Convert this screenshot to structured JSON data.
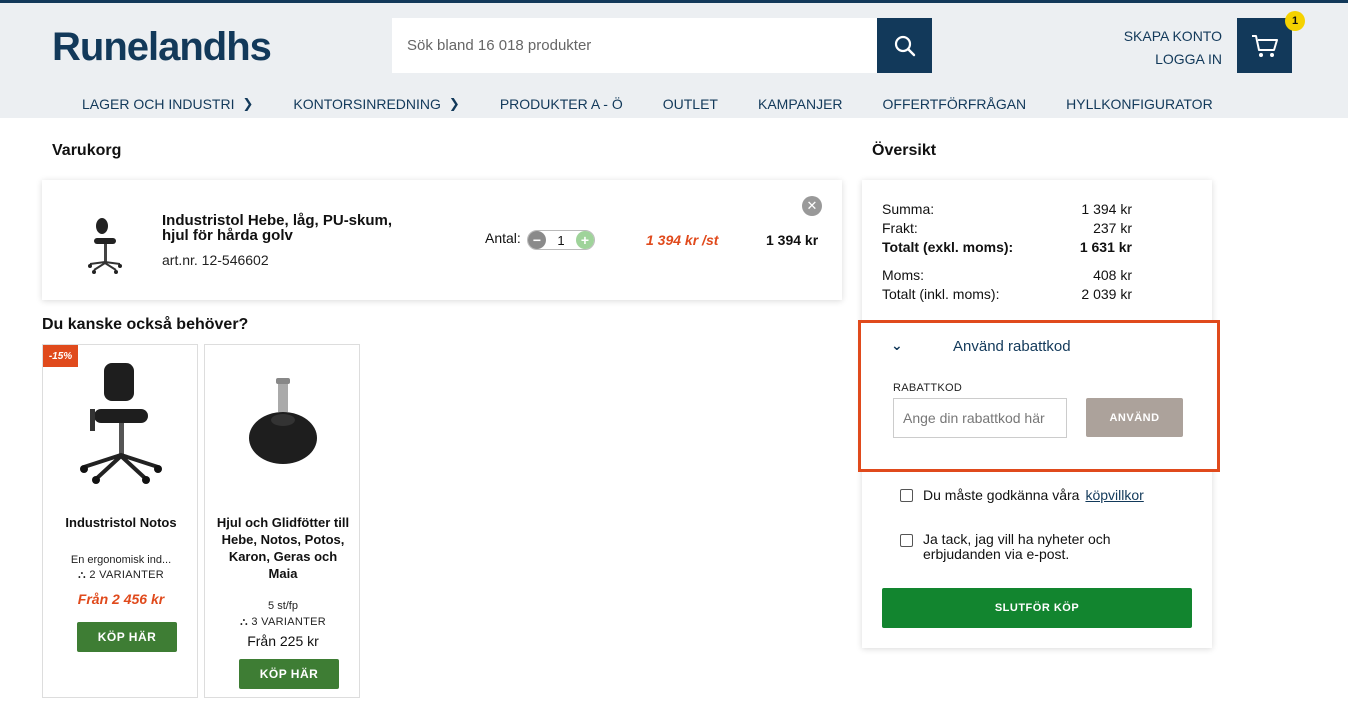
{
  "header": {
    "logo": "Runelandhs",
    "search_placeholder": "Sök bland 16 018 produkter",
    "create_account": "SKAPA KONTO",
    "login": "LOGGA IN",
    "cart_count": "1"
  },
  "nav": [
    {
      "label": "LAGER OCH INDUSTRI",
      "has_chevron": true
    },
    {
      "label": "KONTORSINREDNING",
      "has_chevron": true
    },
    {
      "label": "PRODUKTER A - Ö",
      "has_chevron": false
    },
    {
      "label": "OUTLET",
      "has_chevron": false
    },
    {
      "label": "KAMPANJER",
      "has_chevron": false
    },
    {
      "label": "OFFERTFÖRFRÅGAN",
      "has_chevron": false
    },
    {
      "label": "HYLLKONFIGURATOR",
      "has_chevron": false
    }
  ],
  "cart": {
    "heading": "Varukorg",
    "item": {
      "name": "Industristol Hebe, låg, PU-skum, hjul för hårda golv",
      "art_nr": "art.nr. 12-546602",
      "qty_label": "Antal:",
      "qty": "1",
      "unit_price": "1 394 kr /st",
      "total": "1 394 kr"
    }
  },
  "recommendations": {
    "heading": "Du kanske också behöver?",
    "products": [
      {
        "badge": "-15%",
        "name": "Industristol Notos",
        "desc": "En ergonomisk ind...",
        "variants": "2 VARIANTER",
        "price": "Från 2 456 kr",
        "buy": "KÖP HÄR"
      },
      {
        "name": "Hjul och Glidfötter till Hebe, Notos, Potos, Karon, Geras och Maia",
        "desc": "5 st/fp",
        "variants": "3 VARIANTER",
        "price": "Från 225 kr",
        "buy": "KÖP HÄR"
      }
    ]
  },
  "overview": {
    "heading": "Översikt",
    "rows": [
      {
        "label": "Summa:",
        "value": "1 394 kr"
      },
      {
        "label": "Frakt:",
        "value": "237 kr"
      },
      {
        "label": "Totalt (exkl. moms):",
        "value": "1 631 kr"
      },
      {
        "label": "Moms:",
        "value": "408 kr"
      },
      {
        "label": "Totalt (inkl. moms):",
        "value": "2 039 kr"
      }
    ],
    "promo_toggle": "Använd rabattkod",
    "promo_label": "RABATTKOD",
    "promo_placeholder": "Ange din rabattkod här",
    "promo_apply": "ANVÄND",
    "terms_text": "Du måste godkänna våra",
    "terms_link": "köpvillkor",
    "newsletter_text": "Ja tack, jag vill ha nyheter och erbjudanden via e-post.",
    "checkout": "SLUTFÖR KÖP"
  },
  "colors": {
    "brand": "#12395a",
    "sale": "#e04a1c",
    "buy": "#3e7d34",
    "checkout": "#12852f",
    "highlight": "#e04a1c"
  }
}
